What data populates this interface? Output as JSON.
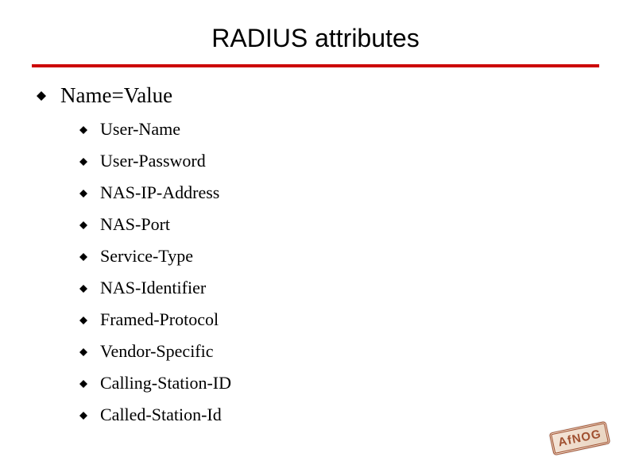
{
  "title": "RADIUS attributes",
  "heading": "Name=Value",
  "items": [
    "User-Name",
    "User-Password",
    "NAS-IP-Address",
    "NAS-Port",
    "Service-Type",
    "NAS-Identifier",
    "Framed-Protocol",
    "Vendor-Specific",
    "Calling-Station-ID",
    "Called-Station-Id"
  ],
  "logo_text": "AfNOG",
  "colors": {
    "rule": "#cc0000",
    "bullet": "#000000",
    "logo": "#a05030"
  }
}
